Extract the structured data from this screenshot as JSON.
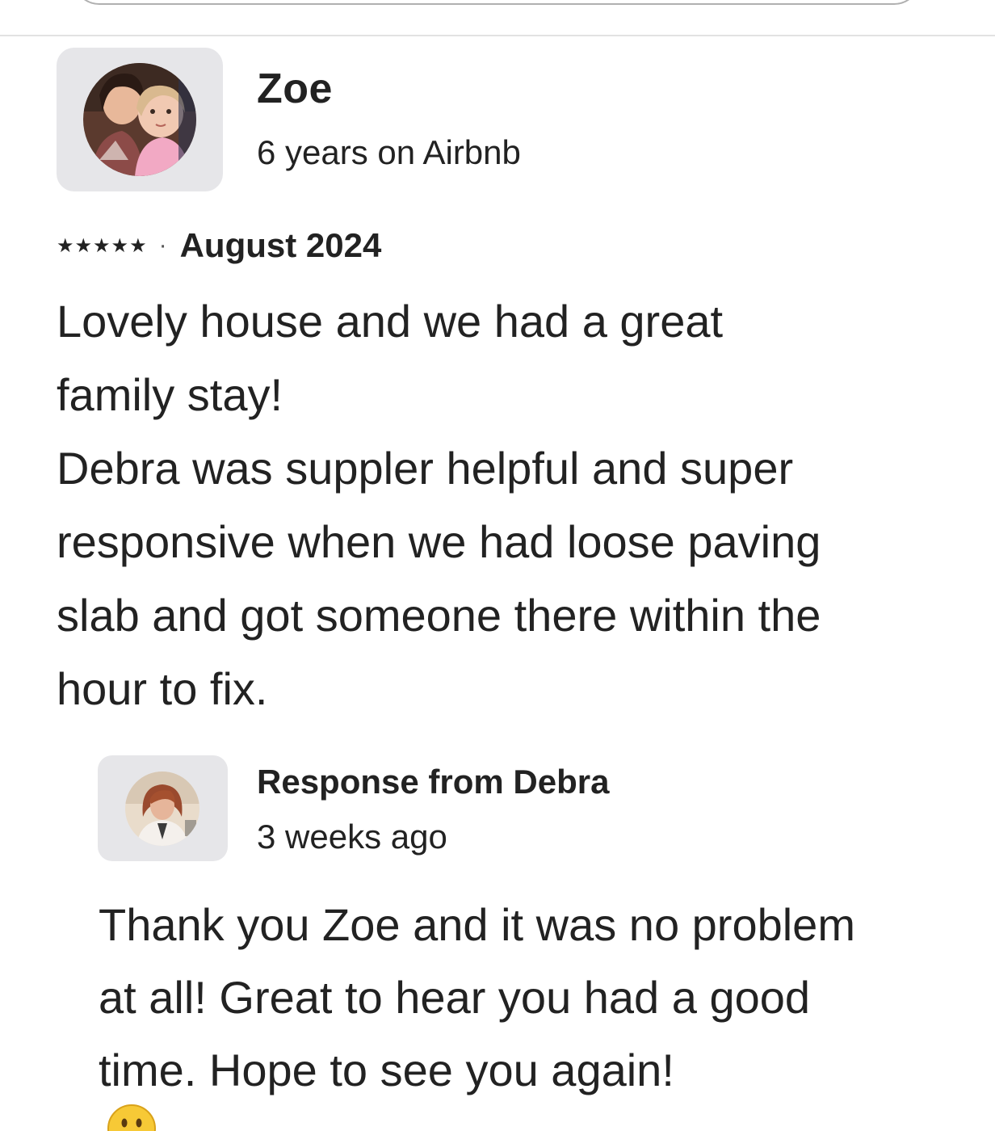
{
  "review": {
    "reviewer_name": "Zoe",
    "reviewer_meta": "6 years on Airbnb",
    "rating_stars": "★★★★★",
    "rating_value": 5,
    "rating_max": 5,
    "separator": "·",
    "date": "August 2024",
    "text_lines": [
      "Lovely house and we had a great",
      "family stay!",
      "Debra was suppler helpful and super",
      "responsive when we had loose paving",
      "slab and got someone there within the",
      "hour to fix."
    ]
  },
  "response": {
    "title": "Response from Debra",
    "time": "3 weeks ago",
    "text_lines": [
      "Thank you Zoe and it was no problem",
      "at all! Great to hear you had a good",
      "time. Hope to see you again!"
    ],
    "emoji_icon": "grinning-face-emoji"
  },
  "colors": {
    "text": "#222222",
    "avatar_tile": "#e6e6e9",
    "divider": "#e2e2e2"
  }
}
